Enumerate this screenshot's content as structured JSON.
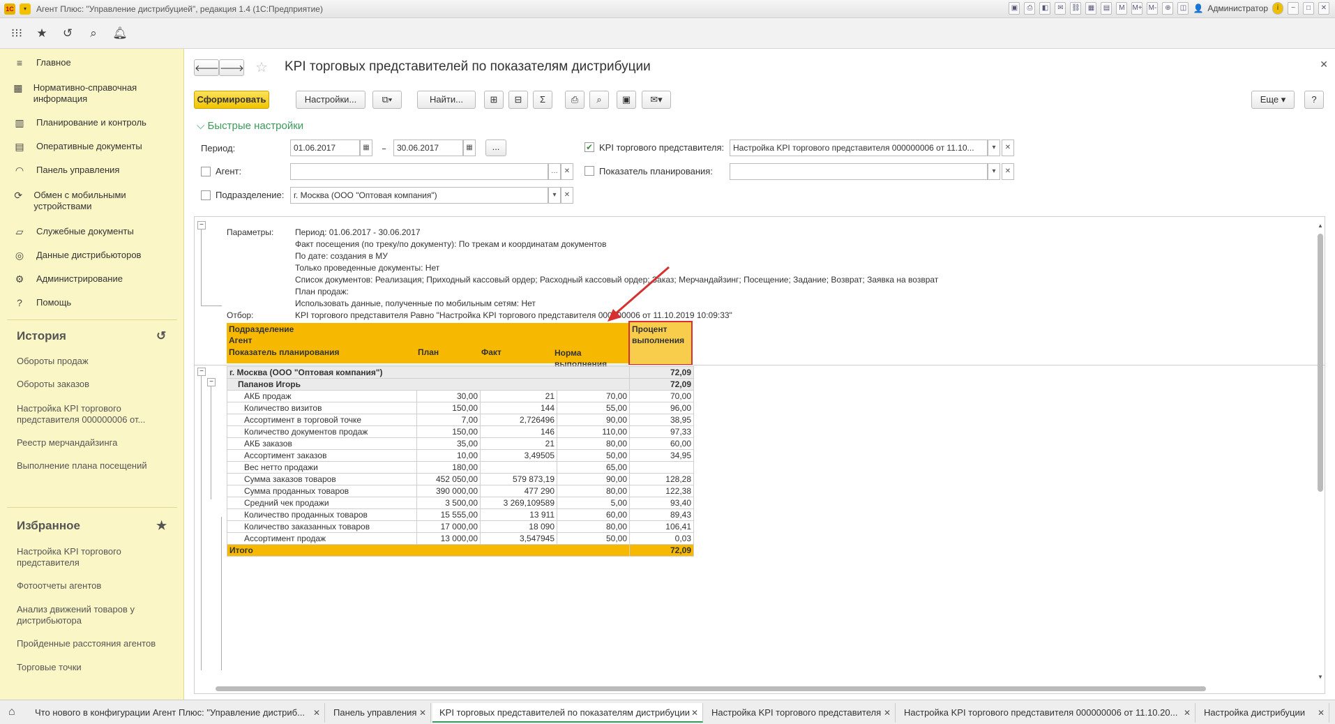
{
  "window": {
    "title": "Агент Плюс: \"Управление дистрибуцией\", редакция 1.4  (1С:Предприятие)",
    "user": "Администратор"
  },
  "sidebar": {
    "items": [
      {
        "icon": "menu-icon",
        "label": "Главное"
      },
      {
        "icon": "grid-icon",
        "label": "Нормативно-справочная информация"
      },
      {
        "icon": "chart-icon",
        "label": "Планирование и контроль"
      },
      {
        "icon": "doc-icon",
        "label": "Оперативные документы"
      },
      {
        "icon": "gauge-icon",
        "label": "Панель управления"
      },
      {
        "icon": "sync-icon",
        "label": "Обмен с мобильными устройствами"
      },
      {
        "icon": "folder-icon",
        "label": "Служебные документы"
      },
      {
        "icon": "data-icon",
        "label": "Данные дистрибьюторов"
      },
      {
        "icon": "gear-icon",
        "label": "Администрирование"
      },
      {
        "icon": "help-icon",
        "label": "Помощь"
      }
    ],
    "history": {
      "title": "История",
      "items": [
        "Обороты продаж",
        "Обороты заказов",
        "Настройка KPI торгового представителя 000000006 от...",
        "Реестр мерчандайзинга",
        "Выполнение плана посещений"
      ]
    },
    "favorites": {
      "title": "Избранное",
      "items": [
        "Настройка KPI торгового представителя",
        "Фотоотчеты агентов",
        "Анализ движений товаров у дистрибьютора",
        "Пройденные расстояния агентов",
        "Торговые точки"
      ]
    }
  },
  "page": {
    "title": "KPI торговых представителей по показателям дистрибуции",
    "buttons": {
      "generate": "Сформировать",
      "settings": "Настройки...",
      "find": "Найти...",
      "more": "Еще",
      "help": "?"
    },
    "quick_settings_title": "Быстрые настройки",
    "period_label": "Период:",
    "period_from": "01.06.2017",
    "period_to": "30.06.2017",
    "period_dash": "–",
    "period_btn": "...",
    "agent_label": "Агент:",
    "agent_value": "",
    "division_label": "Подразделение:",
    "division_value": "г. Москва  (ООО \"Оптовая компания\")",
    "kpi_label": "KPI торгового представителя:",
    "kpi_value": "Настройка KPI торгового представителя 000000006 от 11.10...",
    "indicator_label": "Показатель планирования:",
    "indicator_value": ""
  },
  "report": {
    "params_label": "Параметры:",
    "params": [
      "Период: 01.06.2017 - 30.06.2017",
      "Факт посещения (по треку/по документу): По трекам и координатам документов",
      "По дате: создания в МУ",
      "Только проведенные документы: Нет",
      "Список документов: Реализация; Приходный кассовый ордер; Расходный кассовый ордер; Заказ; Мерчандайзинг; Посещение; Задание; Возврат; Заявка на возврат",
      "План продаж:",
      "Использовать данные, полученные по мобильным сетям: Нет"
    ],
    "filter_label": "Отбор:",
    "filter": " KPI торгового представителя Равно \"Настройка KPI торгового представителя 000000006 от 11.10.2019 10:09:33\"",
    "headers": {
      "division": "Подразделение",
      "agent": "Агент",
      "indicator": "Показатель планирования",
      "plan": "План",
      "fact": "Факт",
      "norm": "Норма выполнения",
      "percent": "Процент выполнения"
    },
    "group": {
      "name": "г. Москва  (ООО \"Оптовая компания\")",
      "percent": "72,09"
    },
    "agent": {
      "name": "Папанов Игорь",
      "percent": "72,09"
    },
    "rows": [
      [
        "АКБ продаж",
        "30,00",
        "21",
        "70,00",
        "70,00"
      ],
      [
        "Количество визитов",
        "150,00",
        "144",
        "55,00",
        "96,00"
      ],
      [
        "Ассортимент в торговой точке",
        "7,00",
        "2,726496",
        "90,00",
        "38,95"
      ],
      [
        "Количество документов продаж",
        "150,00",
        "146",
        "110,00",
        "97,33"
      ],
      [
        "АКБ заказов",
        "35,00",
        "21",
        "80,00",
        "60,00"
      ],
      [
        "Ассортимент заказов",
        "10,00",
        "3,49505",
        "50,00",
        "34,95"
      ],
      [
        "Вес нетто продажи",
        "180,00",
        "",
        "65,00",
        ""
      ],
      [
        "Сумма заказов товаров",
        "452 050,00",
        "579 873,19",
        "90,00",
        "128,28"
      ],
      [
        "Сумма проданных товаров",
        "390 000,00",
        "477 290",
        "80,00",
        "122,38"
      ],
      [
        "Средний чек продажи",
        "3 500,00",
        "3 269,109589",
        "5,00",
        "93,40"
      ],
      [
        "Количество проданных товаров",
        "15 555,00",
        "13 911",
        "60,00",
        "89,43"
      ],
      [
        "Количество заказанных товаров",
        "17 000,00",
        "18 090",
        "80,00",
        "106,41"
      ],
      [
        "Ассортимент продаж",
        "13 000,00",
        "3,547945",
        "50,00",
        "0,03"
      ]
    ],
    "total": {
      "label": "Итого",
      "percent": "72,09"
    }
  },
  "bottom_tabs": [
    {
      "label": "Что нового в конфигурации Агент Плюс: \"Управление дистриб...",
      "active": false
    },
    {
      "label": "Панель управления",
      "active": false
    },
    {
      "label": "KPI торговых представителей по показателям дистрибуции",
      "active": true
    },
    {
      "label": "Настройка KPI торгового представителя",
      "active": false
    },
    {
      "label": "Настройка KPI торгового представителя 000000006 от 11.10.20...",
      "active": false
    },
    {
      "label": "Настройка дистрибуции",
      "active": false
    }
  ],
  "colors": {
    "accent": "#f6b800",
    "sidebar": "#fbf6c6",
    "highlight": "#d63030",
    "generate_btn": "#f0c400"
  }
}
